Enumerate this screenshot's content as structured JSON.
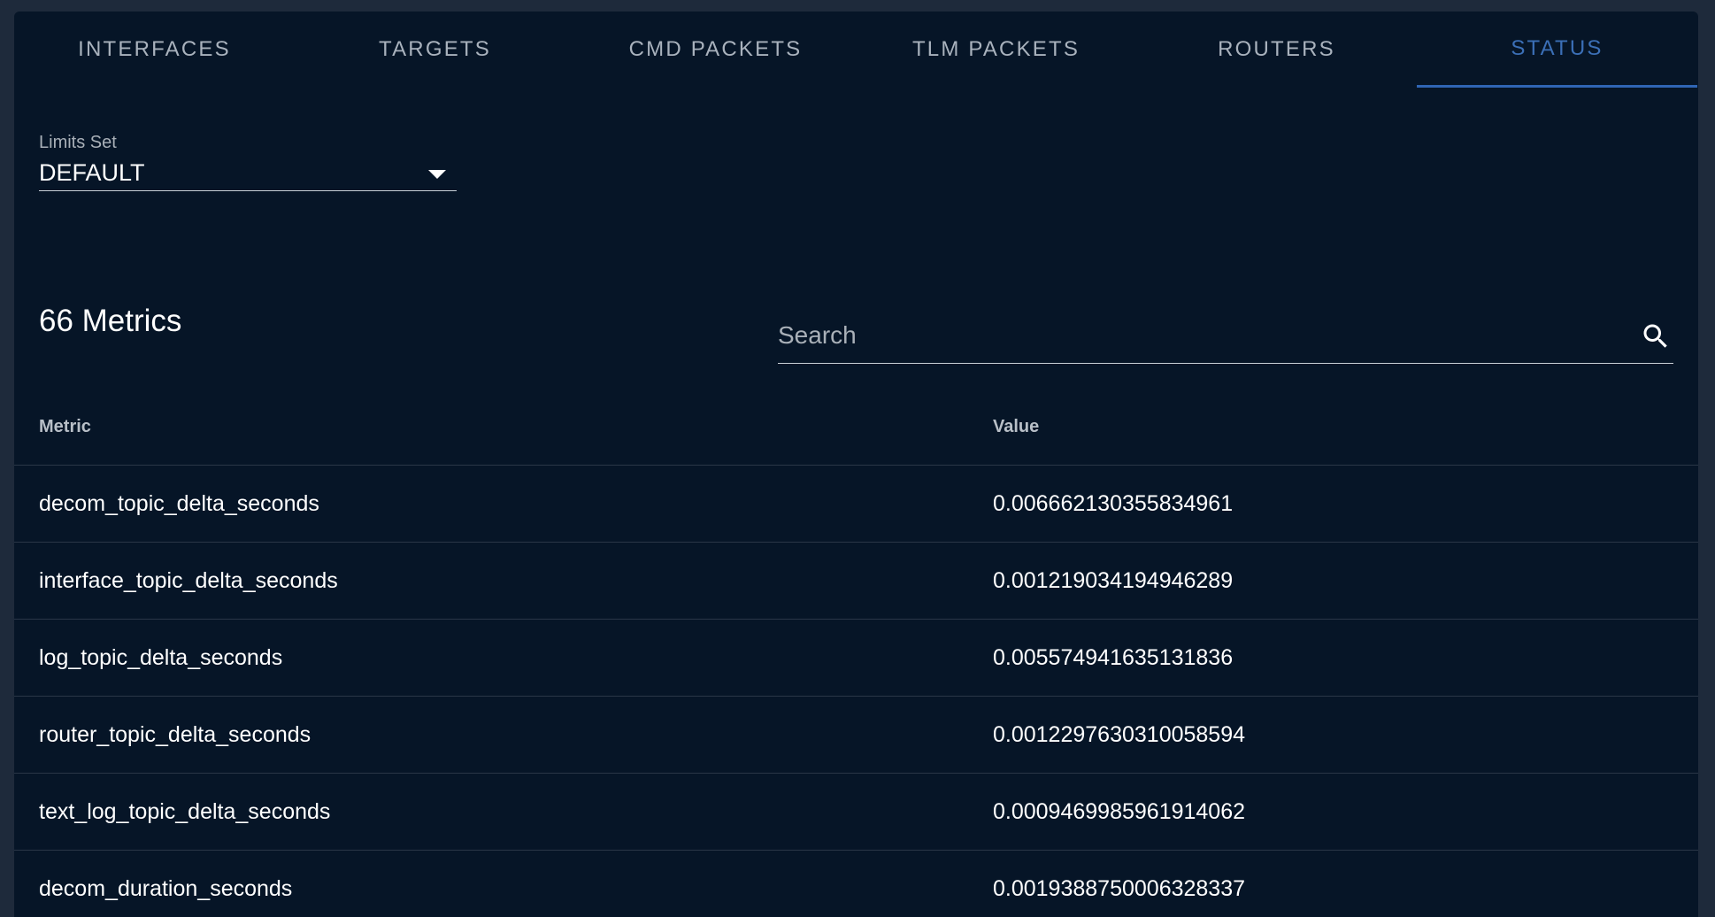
{
  "tabs": [
    {
      "label": "INTERFACES"
    },
    {
      "label": "TARGETS"
    },
    {
      "label": "CMD PACKETS"
    },
    {
      "label": "TLM PACKETS"
    },
    {
      "label": "ROUTERS"
    },
    {
      "label": "STATUS",
      "active": true
    }
  ],
  "limits_set": {
    "label": "Limits Set",
    "value": "DEFAULT"
  },
  "metrics": {
    "title": "66 Metrics",
    "search_placeholder": "Search",
    "columns": {
      "metric": "Metric",
      "value": "Value"
    },
    "rows": [
      {
        "metric": "decom_topic_delta_seconds",
        "value": "0.006662130355834961"
      },
      {
        "metric": "interface_topic_delta_seconds",
        "value": "0.001219034194946289"
      },
      {
        "metric": "log_topic_delta_seconds",
        "value": "0.005574941635131836"
      },
      {
        "metric": "router_topic_delta_seconds",
        "value": "0.0012297630310058594"
      },
      {
        "metric": "text_log_topic_delta_seconds",
        "value": "0.0009469985961914062"
      },
      {
        "metric": "decom_duration_seconds",
        "value": "0.0019388750006328337"
      }
    ]
  },
  "colors": {
    "page_background": "#1e2a3b",
    "card_background": "#061527",
    "active_tab": "#3b6fb6",
    "text_primary": "#ffffff",
    "text_muted": "#a9b2bd"
  }
}
